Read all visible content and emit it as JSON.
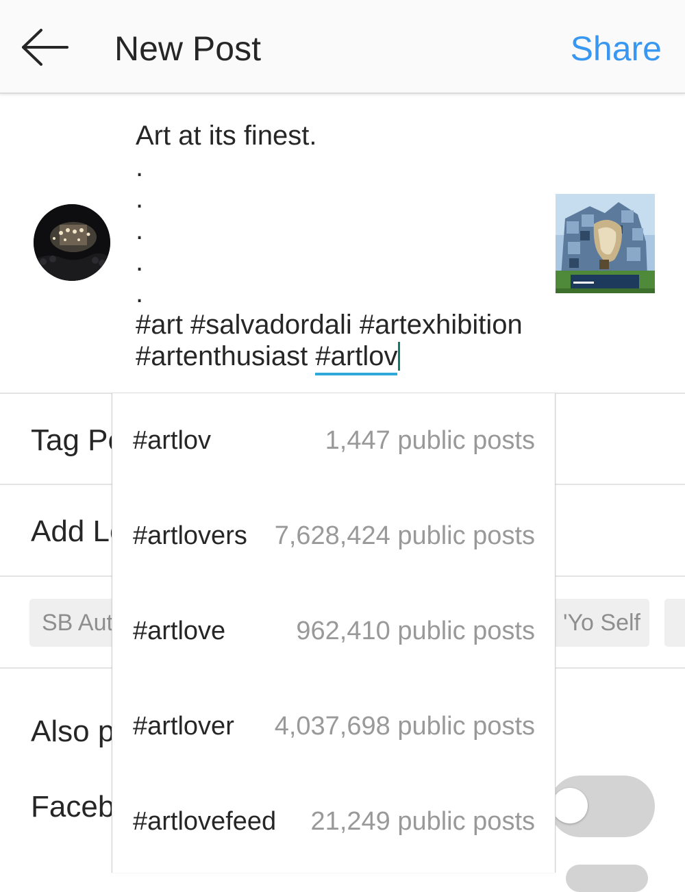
{
  "colors": {
    "accent": "#3897f0",
    "hashtag_underline": "#2ea8d8",
    "cursor": "#127a6d"
  },
  "header": {
    "title": "New Post",
    "share_label": "Share",
    "back_icon": "arrow-left-icon"
  },
  "post": {
    "caption_first_line": "Art at its finest.",
    "dots": [
      ".",
      ".",
      ".",
      ".",
      "."
    ],
    "hashtags_line1": "#art #salvadordali #artexhibition",
    "hashtags_line2_prefix": "#artenthusiast ",
    "current_hashtag": "#artlov"
  },
  "rows": {
    "tag_people": "Tag Pe",
    "add_location": "Add Lo",
    "also_post": "Also p",
    "facebook": "Faceb"
  },
  "location_chips": [
    "SB Auto",
    "'Yo Self"
  ],
  "suggestions": [
    {
      "tag": "#artlov",
      "count": "1,447 public posts"
    },
    {
      "tag": "#artlovers",
      "count": "7,628,424 public posts"
    },
    {
      "tag": "#artlove",
      "count": "962,410 public posts"
    },
    {
      "tag": "#artlover",
      "count": "4,037,698 public posts"
    },
    {
      "tag": "#artlovefeed",
      "count": "21,249 public posts"
    }
  ],
  "facebook_toggle_on": false
}
